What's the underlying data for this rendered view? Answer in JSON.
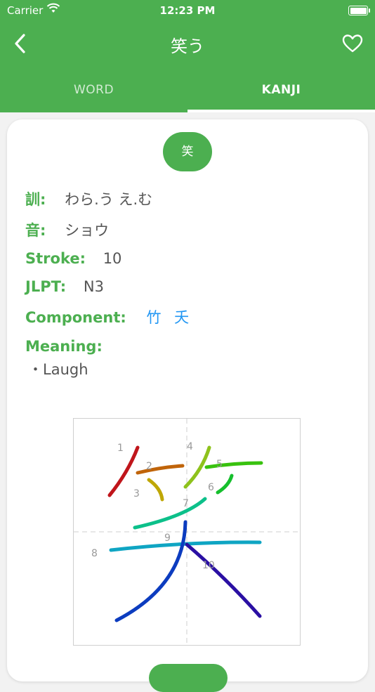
{
  "status": {
    "carrier": "Carrier",
    "time": "12:23 PM"
  },
  "nav": {
    "title": "笑う",
    "back_icon": "chevron-left-icon",
    "fav_icon": "heart-outline-icon"
  },
  "tabs": [
    {
      "label": "WORD",
      "selected": false
    },
    {
      "label": "KANJI",
      "selected": true
    }
  ],
  "colors": {
    "primary": "#4caf50",
    "link": "#2196f3",
    "text": "#555555"
  },
  "kanji": {
    "character": "笑",
    "kun_label": "訓:",
    "kun_value": "わら.う え.む",
    "on_label": "音:",
    "on_value": "ショウ",
    "stroke_label": "Stroke:",
    "stroke_value": "10",
    "jlpt_label": "JLPT:",
    "jlpt_value": "N3",
    "component_label": "Component:",
    "components": [
      "竹",
      "夭"
    ],
    "meaning_label": "Meaning:",
    "meanings": [
      "・Laugh"
    ]
  },
  "stroke_numbers": [
    "1",
    "2",
    "3",
    "4",
    "5",
    "6",
    "7",
    "8",
    "9",
    "10"
  ]
}
